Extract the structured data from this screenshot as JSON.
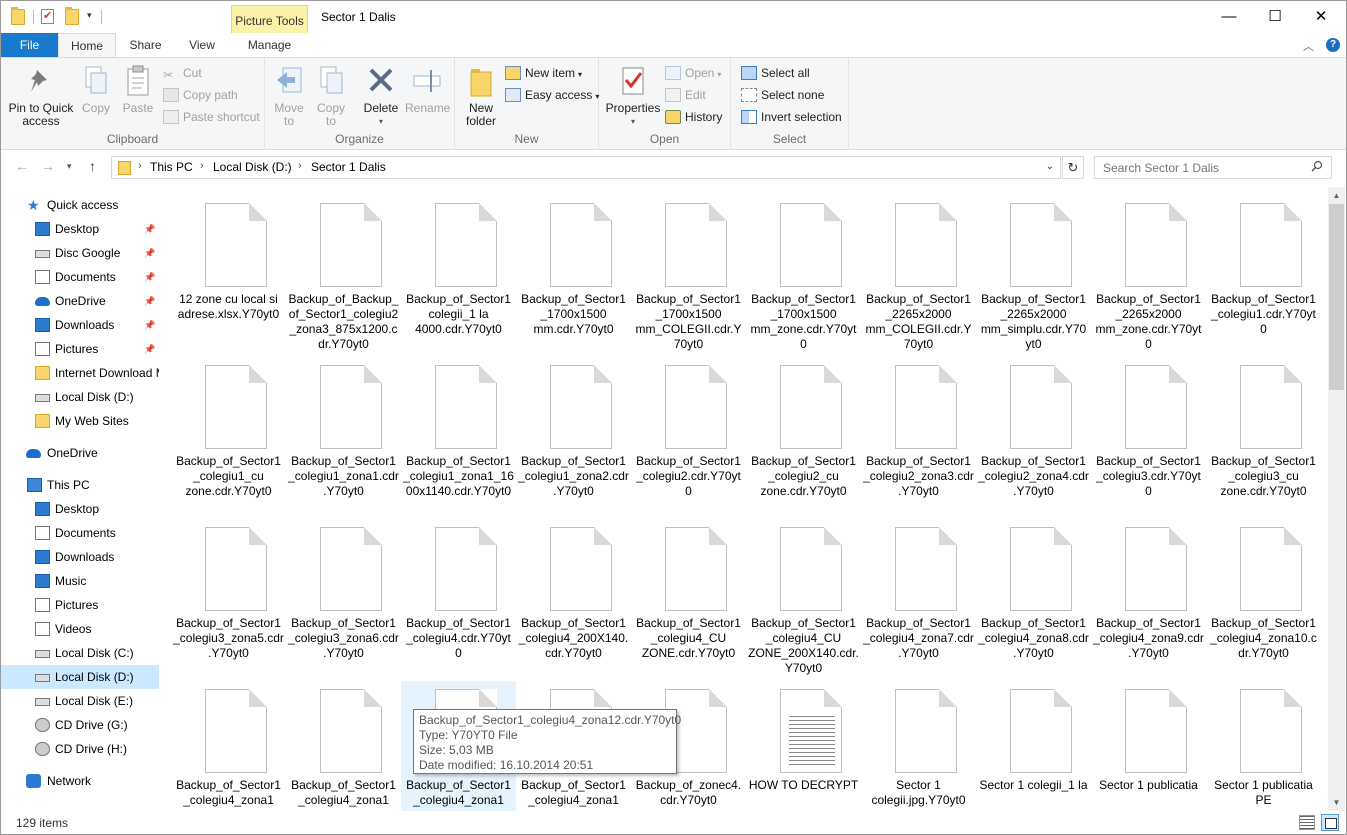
{
  "window": {
    "title": "Sector 1 Dalis",
    "picture_tools_label": "Picture Tools",
    "min_label": "—",
    "max_label": "☐",
    "close_label": "✕"
  },
  "tabs": {
    "file": "File",
    "home": "Home",
    "share": "Share",
    "view": "View",
    "manage": "Manage"
  },
  "ribbon": {
    "clipboard": {
      "label": "Clipboard",
      "pin_line1": "Pin to Quick",
      "pin_line2": "access",
      "copy": "Copy",
      "paste": "Paste",
      "cut": "Cut",
      "copy_path": "Copy path",
      "paste_shortcut": "Paste shortcut"
    },
    "organize": {
      "label": "Organize",
      "move_to": "Move",
      "move_to2": "to",
      "copy_to": "Copy",
      "copy_to2": "to",
      "delete": "Delete",
      "rename": "Rename"
    },
    "new": {
      "label": "New",
      "new_folder1": "New",
      "new_folder2": "folder",
      "new_item": "New item",
      "easy_access": "Easy access"
    },
    "open": {
      "label": "Open",
      "properties": "Properties",
      "open": "Open",
      "edit": "Edit",
      "history": "History"
    },
    "select": {
      "label": "Select",
      "select_all": "Select all",
      "select_none": "Select none",
      "invert_selection": "Invert selection"
    }
  },
  "address": {
    "crumbs": [
      "This PC",
      "Local Disk (D:)",
      "Sector 1 Dalis"
    ],
    "search_placeholder": "Search Sector 1 Dalis"
  },
  "nav": {
    "quick_access": "Quick access",
    "qa_items": [
      "Desktop",
      "Disc Google",
      "Documents",
      "OneDrive",
      "Downloads",
      "Pictures",
      "Internet Download M",
      "Local Disk (D:)",
      "My Web Sites"
    ],
    "onedrive": "OneDrive",
    "this_pc": "This PC",
    "pc_items": [
      "Desktop",
      "Documents",
      "Downloads",
      "Music",
      "Pictures",
      "Videos",
      "Local Disk (C:)",
      "Local Disk (D:)",
      "Local Disk (E:)",
      "CD Drive (G:)",
      "CD Drive (H:)"
    ],
    "network": "Network"
  },
  "files": [
    "12 zone cu local si adrese.xlsx.Y70yt0",
    "Backup_of_Backup_of_Sector1_colegiu2_zona3_875x1200.cdr.Y70yt0",
    "Backup_of_Sector1 colegii_1 la 4000.cdr.Y70yt0",
    "Backup_of_Sector1_1700x1500 mm.cdr.Y70yt0",
    "Backup_of_Sector1_1700x1500 mm_COLEGII.cdr.Y70yt0",
    "Backup_of_Sector1_1700x1500 mm_zone.cdr.Y70yt0",
    "Backup_of_Sector1_2265x2000 mm_COLEGII.cdr.Y70yt0",
    "Backup_of_Sector1_2265x2000 mm_simplu.cdr.Y70yt0",
    "Backup_of_Sector1_2265x2000 mm_zone.cdr.Y70yt0",
    "Backup_of_Sector1_colegiu1.cdr.Y70yt0",
    "Backup_of_Sector1_colegiu1_cu zone.cdr.Y70yt0",
    "Backup_of_Sector1_colegiu1_zona1.cdr.Y70yt0",
    "Backup_of_Sector1_colegiu1_zona1_1600x1140.cdr.Y70yt0",
    "Backup_of_Sector1_colegiu1_zona2.cdr.Y70yt0",
    "Backup_of_Sector1_colegiu2.cdr.Y70yt0",
    "Backup_of_Sector1_colegiu2_cu zone.cdr.Y70yt0",
    "Backup_of_Sector1_colegiu2_zona3.cdr.Y70yt0",
    "Backup_of_Sector1_colegiu2_zona4.cdr.Y70yt0",
    "Backup_of_Sector1_colegiu3.cdr.Y70yt0",
    "Backup_of_Sector1_colegiu3_cu zone.cdr.Y70yt0",
    "Backup_of_Sector1_colegiu3_zona5.cdr.Y70yt0",
    "Backup_of_Sector1_colegiu3_zona6.cdr.Y70yt0",
    "Backup_of_Sector1_colegiu4.cdr.Y70yt0",
    "Backup_of_Sector1_colegiu4_200X140.cdr.Y70yt0",
    "Backup_of_Sector1_colegiu4_CU ZONE.cdr.Y70yt0",
    "Backup_of_Sector1_colegiu4_CU ZONE_200X140.cdr.Y70yt0",
    "Backup_of_Sector1_colegiu4_zona7.cdr.Y70yt0",
    "Backup_of_Sector1_colegiu4_zona8.cdr.Y70yt0",
    "Backup_of_Sector1_colegiu4_zona9.cdr.Y70yt0",
    "Backup_of_Sector1_colegiu4_zona10.cdr.Y70yt0",
    "Backup_of_Sector1_colegiu4_zona1",
    "Backup_of_Sector1_colegiu4_zona1",
    "Backup_of_Sector1_colegiu4_zona1",
    "Backup_of_Sector1_colegiu4_zona1",
    "Backup_of_zonec4.cdr.Y70yt0",
    "HOW TO DECRYPT",
    "Sector 1 colegii.jpg.Y70yt0",
    "Sector 1 colegii_1 la",
    "Sector 1 publicatia",
    "Sector 1 publicatia PE"
  ],
  "selected_file_index": 32,
  "text_file_index": 35,
  "tooltip": {
    "name": "Backup_of_Sector1_colegiu4_zona12.cdr.Y70yt0",
    "type": "Type: Y70YT0 File",
    "size": "Size: 5,03 MB",
    "modified": "Date modified: 16.10.2014 20:51"
  },
  "status": {
    "item_count": "129 items"
  },
  "colors": {
    "file_tab": "#1979ca",
    "selection": "#cce8ff",
    "picture_tools": "#f9f3a8"
  }
}
